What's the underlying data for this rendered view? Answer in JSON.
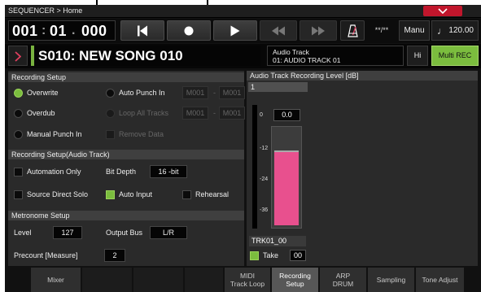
{
  "breadcrumb": "SEQUENCER > Home",
  "transport": {
    "measure": "001",
    "beat": "01",
    "tick": "000",
    "meter": "**/**",
    "tempo_mode": "Manu",
    "tempo_note": "♩",
    "tempo": "120.00"
  },
  "song": {
    "name": "S010: NEW SONG 010",
    "track_type": "Audio Track",
    "track_name": "01: AUDIO TRACK 01",
    "hi_label": "Hi",
    "multi_rec_label": "Multi REC"
  },
  "recording_setup": {
    "title": "Recording Setup",
    "overwrite": "Overwrite",
    "overdub": "Overdub",
    "manual_punch_in": "Manual Punch In",
    "auto_punch_in": "Auto Punch In",
    "loop_all_tracks": "Loop All Tracks",
    "remove_data": "Remove Data",
    "punch_start": "M001",
    "punch_end": "M001",
    "loop_start": "M001",
    "loop_end": "M001",
    "range_dash": "-",
    "selected_mode": "Overwrite"
  },
  "recording_setup_audio": {
    "title": "Recording Setup(Audio Track)",
    "automation_only": "Automation Only",
    "bit_depth_label": "Bit Depth",
    "bit_depth_value": "16 -bit",
    "source_direct_solo": "Source Direct Solo",
    "auto_input": "Auto Input",
    "rehearsal": "Rehearsal",
    "auto_input_checked": true
  },
  "metronome_setup": {
    "title": "Metronome Setup",
    "level_label": "Level",
    "level_value": "127",
    "output_bus_label": "Output Bus",
    "output_bus_value": "L/R",
    "precount_label": "Precount [Measure]",
    "precount_value": "2"
  },
  "audio_level": {
    "title": "Audio Track Recording Level [dB]",
    "track_number": "1",
    "scale": [
      "0",
      "-12",
      "-24",
      "-36"
    ],
    "peak": "0.0",
    "level_fraction": 0.76,
    "track_label": "TRK01_00",
    "take_label": "Take",
    "take_value": "00",
    "take_checked": true
  },
  "tabs": [
    {
      "label": "Mixer",
      "active": false
    },
    {
      "label": "MIDI\nTrack Loop",
      "active": false
    },
    {
      "label": "Recording\nSetup",
      "active": true
    },
    {
      "label": "ARP\nDRUM",
      "active": false
    },
    {
      "label": "Sampling",
      "active": false
    },
    {
      "label": "Tone Adjust",
      "active": false
    }
  ],
  "colors": {
    "accent_green": "#7bbd3e",
    "level_pink": "#e8508e",
    "menu_red": "#c1162c"
  },
  "icons": [
    "chevron-down-icon",
    "rewind-to-start-icon",
    "record-icon",
    "play-icon",
    "rewind-icon",
    "fast-forward-icon",
    "metronome-icon",
    "chevron-right-icon"
  ]
}
